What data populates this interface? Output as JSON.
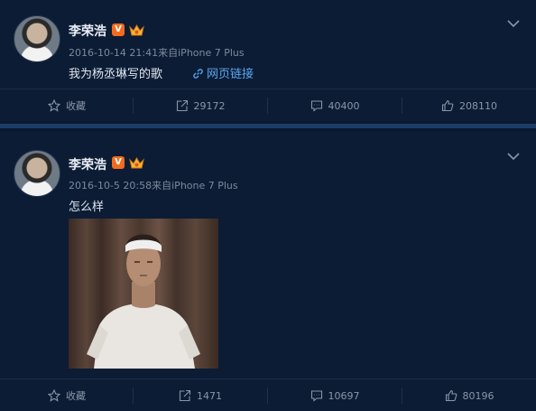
{
  "colors": {
    "background": "#0c1c35",
    "link": "#5aa6ee",
    "v_badge": "#f36b1c"
  },
  "posts": [
    {
      "author": "李荣浩",
      "verified_badge": "V",
      "meta": "2016-10-14 21:41来自iPhone 7 Plus",
      "text": "我为杨丞琳写的歌",
      "link_label": "网页链接",
      "actions": {
        "favorite": "收藏",
        "repost": "29172",
        "comment": "40400",
        "like": "208110"
      }
    },
    {
      "author": "李荣浩",
      "verified_badge": "V",
      "meta": "2016-10-5 20:58来自iPhone 7 Plus",
      "text": "怎么样",
      "actions": {
        "favorite": "收藏",
        "repost": "1471",
        "comment": "10697",
        "like": "80196"
      }
    }
  ]
}
